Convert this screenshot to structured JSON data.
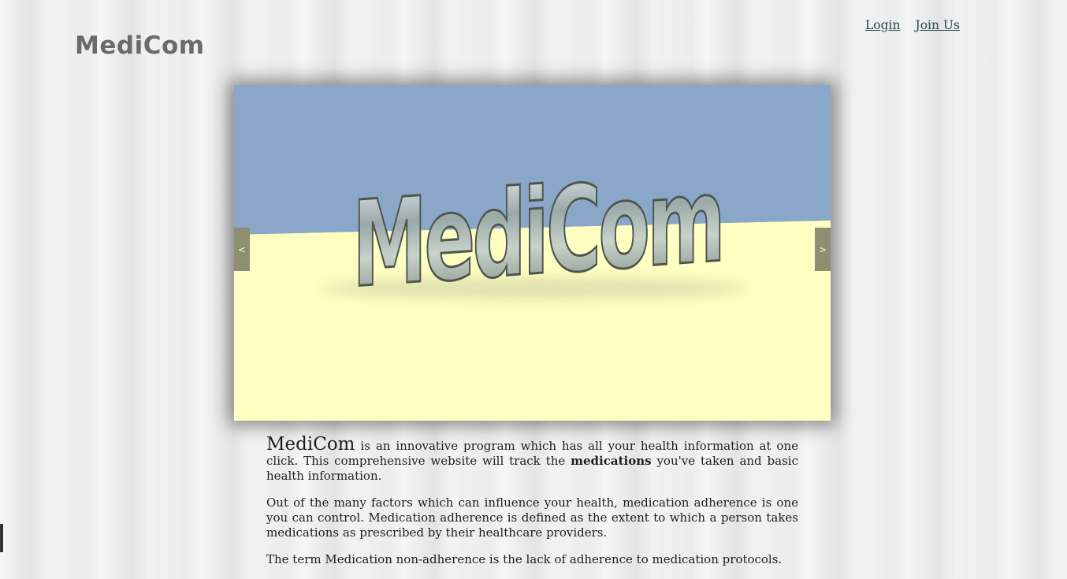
{
  "site": {
    "brand": "MediCom"
  },
  "nav": {
    "login": "Login",
    "join": "Join Us"
  },
  "slider": {
    "prev_label": "<",
    "next_label": ">",
    "image_text": "MediCom",
    "sky_color": "#8aa6c8",
    "floor_color": "#ffffc2"
  },
  "content": {
    "intro_brand": "MediCom",
    "intro_text_1": " is an innovative program which has all your health information at one click. This comprehensive website will track the ",
    "intro_bold": "medications",
    "intro_text_2": " you've taken and basic health information.",
    "para2": "Out of the many factors which can influence your health, medication adherence is one you can control. Medication adherence is defined as the extent to which a person takes medications as prescribed by their healthcare providers.",
    "para3": "The term Medication non-adherence is the lack of adherence to medication protocols."
  }
}
